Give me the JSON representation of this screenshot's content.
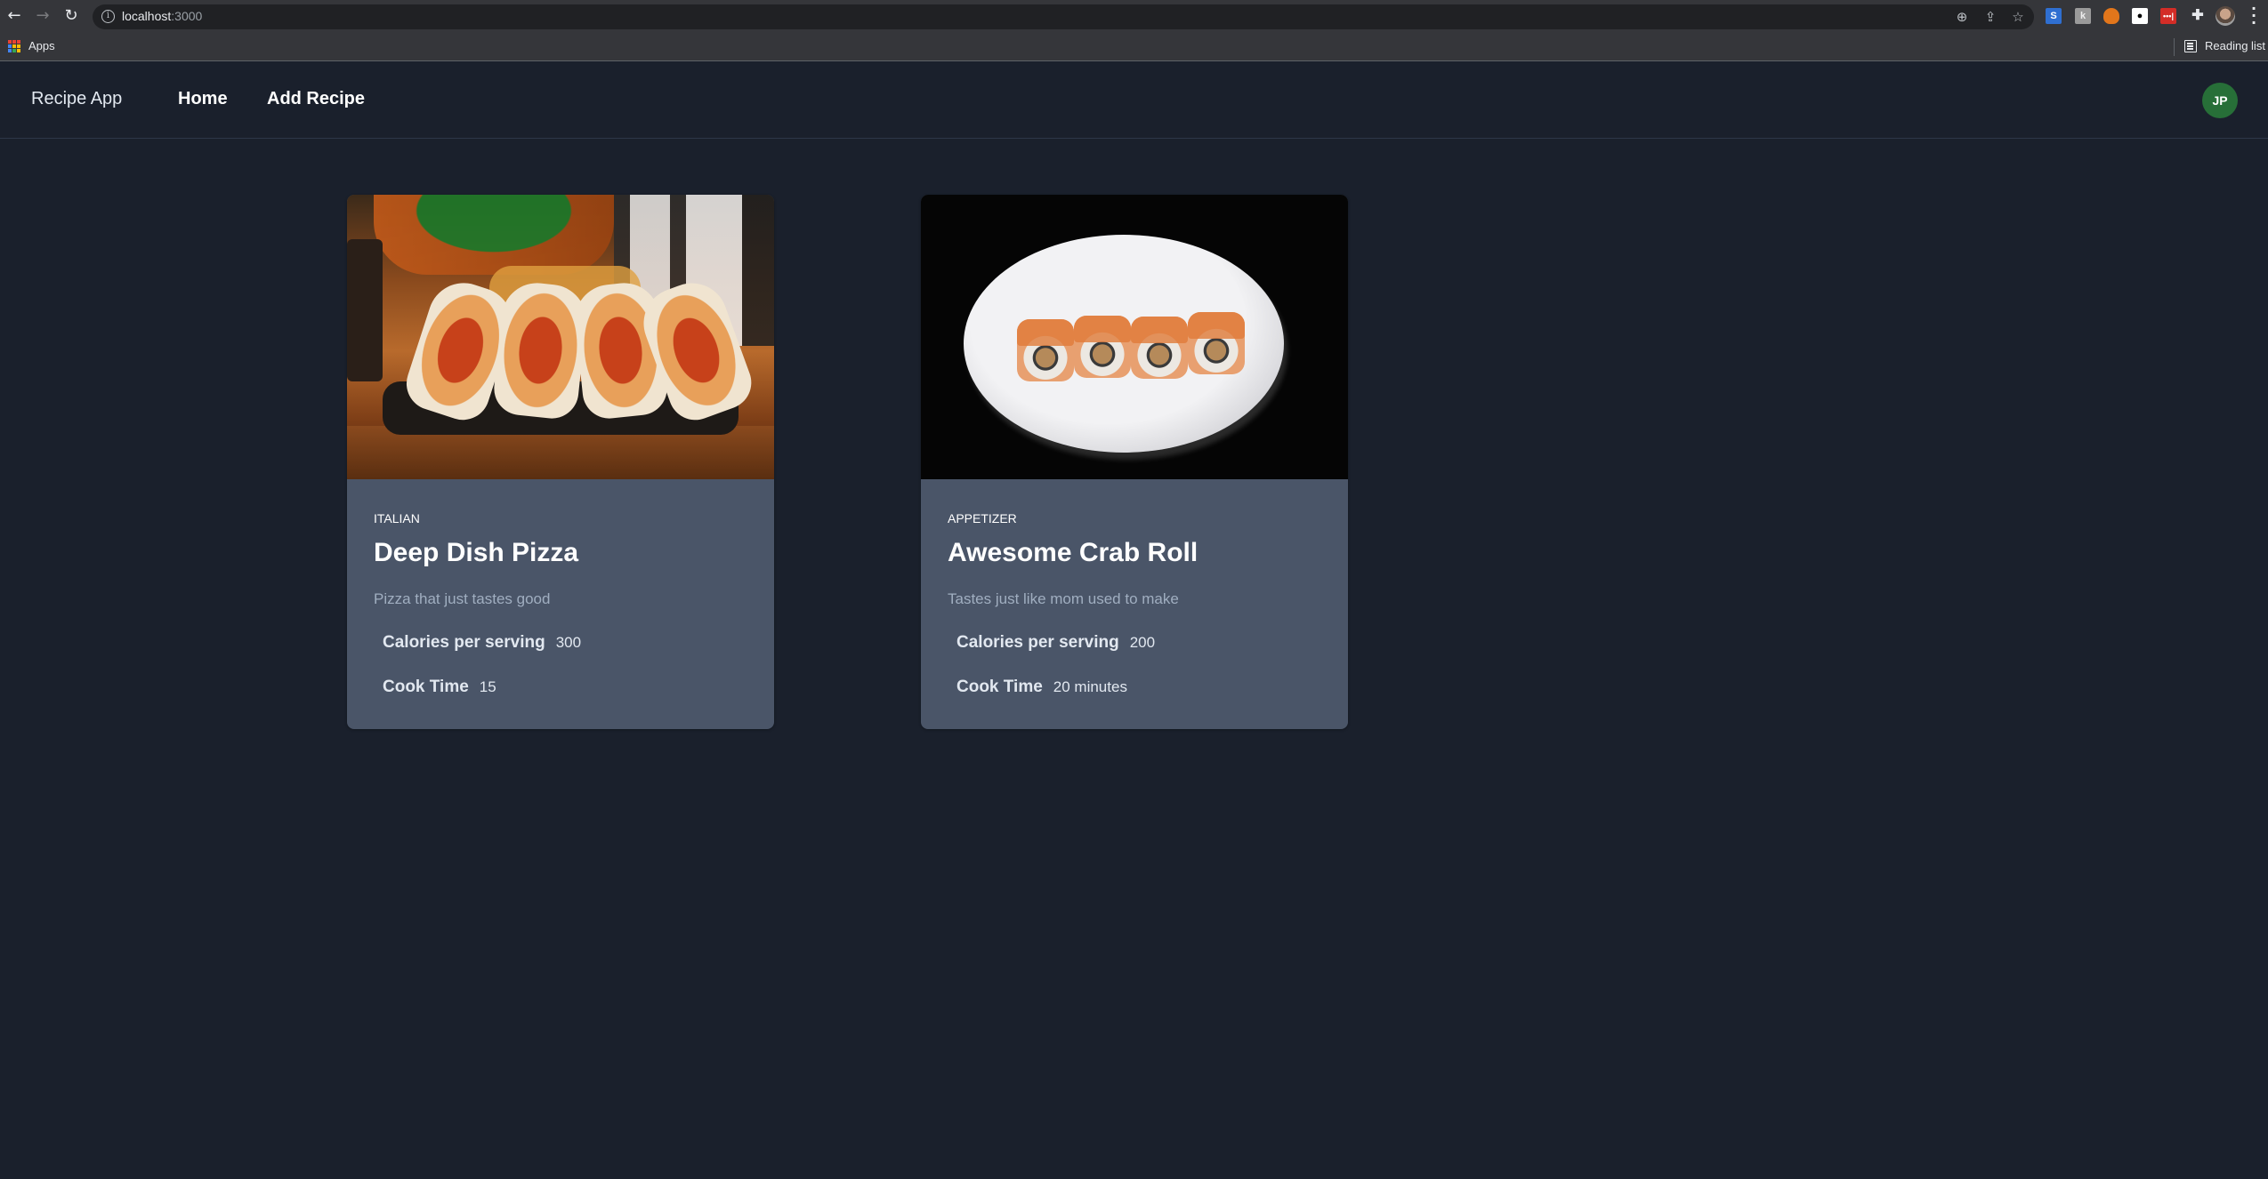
{
  "browser": {
    "url_host": "localhost",
    "url_port": ":3000",
    "bookmarks": [
      {
        "label": "Apps"
      }
    ],
    "reading_list_label": "Reading list",
    "extensions": [
      "extension-s",
      "extension-k",
      "metamask-fox",
      "extension-circle",
      "lastpass"
    ]
  },
  "header": {
    "brand": "Recipe App",
    "nav": [
      {
        "label": "Home"
      },
      {
        "label": "Add Recipe"
      }
    ],
    "avatar_initials": "JP"
  },
  "recipes": [
    {
      "category": "ITALIAN",
      "title": "Deep Dish Pizza",
      "description": "Pizza that just tastes good",
      "calories_label": "Calories per serving",
      "calories_value": "300",
      "cook_time_label": "Cook Time",
      "cook_time_value": "15",
      "image_alt": "hot dogs on a tray"
    },
    {
      "category": "APPETIZER",
      "title": "Awesome Crab Roll",
      "description": "Tastes just like mom used to make",
      "calories_label": "Calories per serving",
      "calories_value": "200",
      "cook_time_label": "Cook Time",
      "cook_time_value": "20 minutes",
      "image_alt": "sushi rolls on a white plate"
    }
  ],
  "colors": {
    "page_bg": "#1a202c",
    "card_bg": "#4a5568",
    "description_text": "#a0aec0",
    "avatar_bg": "#276f38"
  }
}
